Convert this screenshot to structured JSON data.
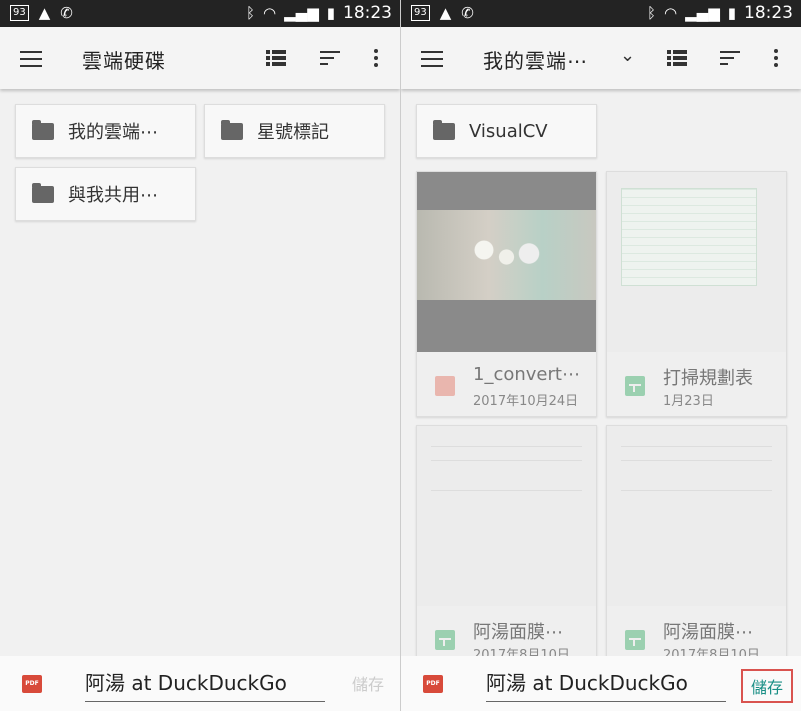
{
  "status": {
    "battery_badge": "93",
    "time": "18:23"
  },
  "left": {
    "title": "雲端硬碟",
    "folders": [
      {
        "name": "我的雲端⋯"
      },
      {
        "name": "星號標記"
      },
      {
        "name": "與我共用⋯"
      }
    ],
    "filename": "阿湯 at DuckDuckGo",
    "save_label": "儲存",
    "pdf_badge": "PDF"
  },
  "right": {
    "title": "我的雲端⋯",
    "folders": [
      {
        "name": "VisualCV"
      }
    ],
    "files": [
      {
        "name": "1_convert⋯",
        "date": "2017年10月24日",
        "type": "video"
      },
      {
        "name": "打掃規劃表",
        "date": "1月23日",
        "type": "spreadsheet"
      },
      {
        "name": "阿湯面膜⋯",
        "date": "2017年8月10日",
        "type": "spreadsheet"
      },
      {
        "name": "阿湯面膜⋯",
        "date": "2017年8月10日",
        "type": "spreadsheet"
      }
    ],
    "filename": "阿湯 at DuckDuckGo",
    "save_label": "儲存",
    "pdf_badge": "PDF"
  },
  "colors": {
    "accent": "#1a8f86",
    "highlight": "#d9534f"
  }
}
